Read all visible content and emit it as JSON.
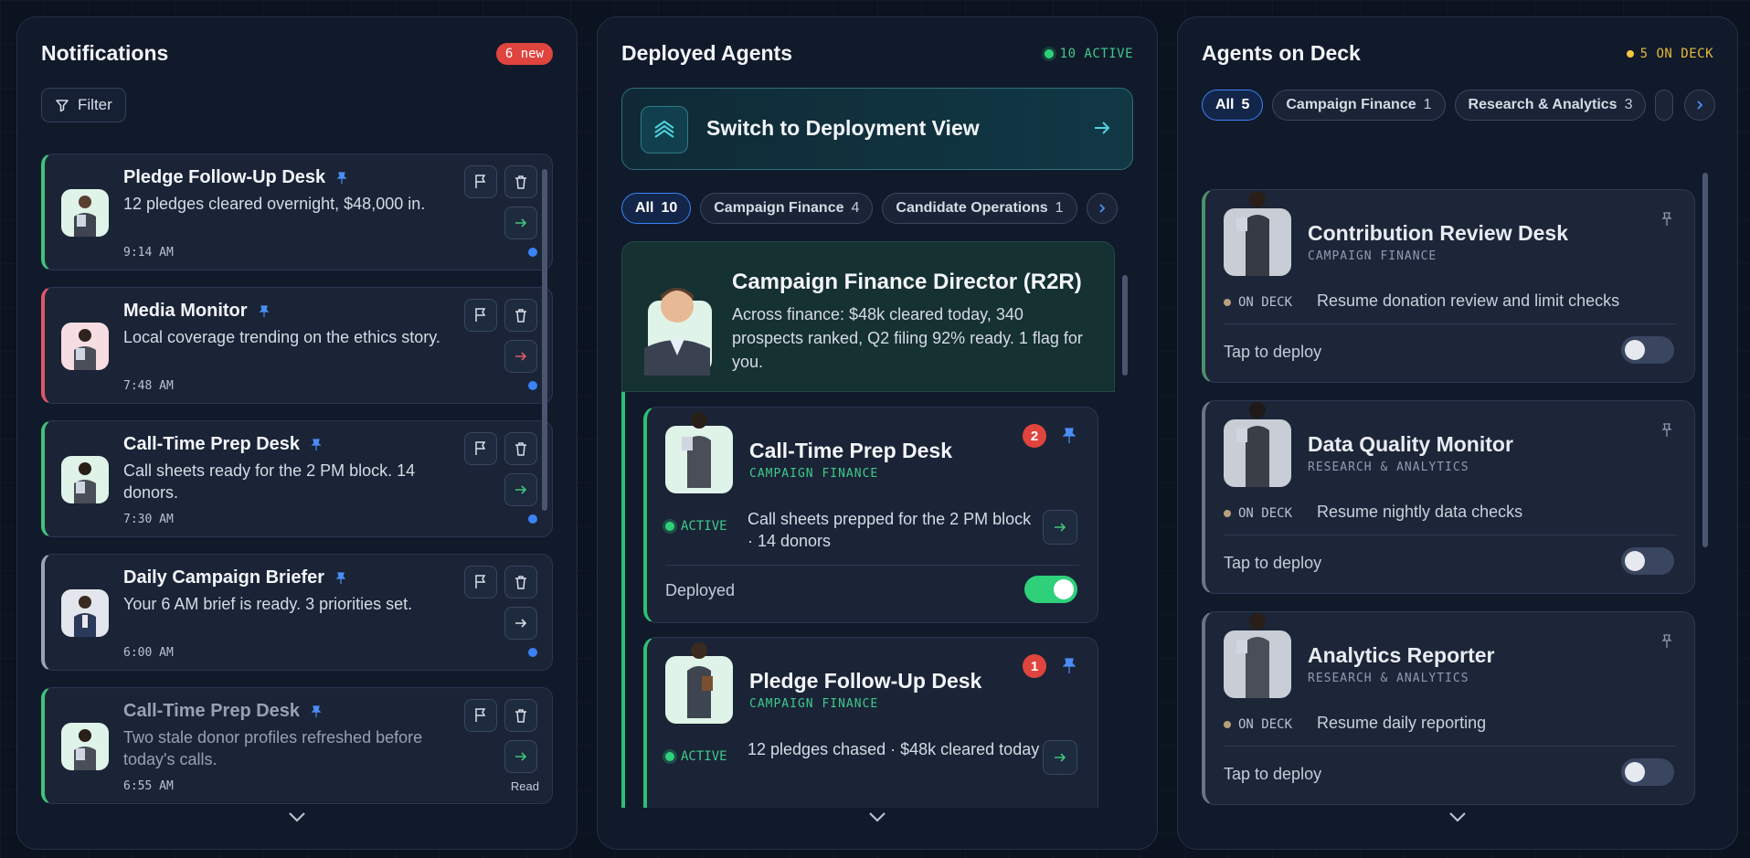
{
  "colors": {
    "accent_blue": "#3b82f6",
    "green": "#2fd07a",
    "red": "#e0443e",
    "amber": "#f5c542"
  },
  "notifications": {
    "title": "Notifications",
    "new_badge": "6 new",
    "filter_label": "Filter",
    "items": [
      {
        "title": "Pledge Follow-Up Desk",
        "body": "12 pledges cleared overnight, $48,000 in.",
        "time": "9:14 AM",
        "accent": "#3ec47a",
        "avatar_bg": "#dff3e8"
      },
      {
        "title": "Media Monitor",
        "body": "Local coverage trending on the ethics story.",
        "time": "7:48 AM",
        "accent": "#e0566a",
        "avatar_bg": "#f6dde2"
      },
      {
        "title": "Call-Time Prep Desk",
        "body": "Call sheets ready for the 2 PM block. 14 donors.",
        "time": "7:30 AM",
        "accent": "#3ec47a",
        "avatar_bg": "#dff3e8"
      },
      {
        "title": "Daily Campaign Briefer",
        "body": "Your 6 AM brief is ready. 3 priorities set.",
        "time": "6:00 AM",
        "accent": "#9aa3b2",
        "avatar_bg": "#e3e6ec"
      },
      {
        "title": "Call-Time Prep Desk",
        "body": "Two stale donor profiles refreshed before today's calls.",
        "time": "6:55 AM",
        "accent": "#3ec47a",
        "avatar_bg": "#dff3e8",
        "read_label": "Read"
      }
    ]
  },
  "deployed": {
    "title": "Deployed Agents",
    "status": "10 ACTIVE",
    "switch_label": "Switch to Deployment View",
    "chips": [
      {
        "label": "All",
        "count": "10"
      },
      {
        "label": "Campaign Finance",
        "count": "4"
      },
      {
        "label": "Candidate Operations",
        "count": "1"
      }
    ],
    "director": {
      "title": "Campaign Finance Director (R2R)",
      "body": "Across finance: $48k cleared today, 340 prospects ranked, Q2 filing 92% ready. 1 flag for you."
    },
    "agents": [
      {
        "name": "Call-Time Prep Desk",
        "category": "CAMPAIGN FINANCE",
        "count": "2",
        "state": "ACTIVE",
        "desc": "Call sheets prepped for the 2 PM block · 14 donors",
        "footer": "Deployed"
      },
      {
        "name": "Pledge Follow-Up Desk",
        "category": "CAMPAIGN FINANCE",
        "count": "1",
        "state": "ACTIVE",
        "desc": "12 pledges chased · $48k cleared today"
      }
    ]
  },
  "deck": {
    "title": "Agents on Deck",
    "status": "5 ON DECK",
    "chips": [
      {
        "label": "All",
        "count": "5"
      },
      {
        "label": "Campaign Finance",
        "count": "1"
      },
      {
        "label": "Research & Analytics",
        "count": "3"
      }
    ],
    "agents": [
      {
        "name": "Contribution Review Desk",
        "category": "CAMPAIGN FINANCE",
        "state": "ON DECK",
        "resume": "Resume donation review and limit checks",
        "footer": "Tap to deploy",
        "accent": "#4f8f6c"
      },
      {
        "name": "Data Quality Monitor",
        "category": "RESEARCH & ANALYTICS",
        "state": "ON DECK",
        "resume": "Resume nightly data checks",
        "footer": "Tap to deploy",
        "accent": "#6a7486"
      },
      {
        "name": "Analytics Reporter",
        "category": "RESEARCH & ANALYTICS",
        "state": "ON DECK",
        "resume": "Resume daily reporting",
        "footer": "Tap to deploy",
        "accent": "#6a7486"
      }
    ]
  }
}
